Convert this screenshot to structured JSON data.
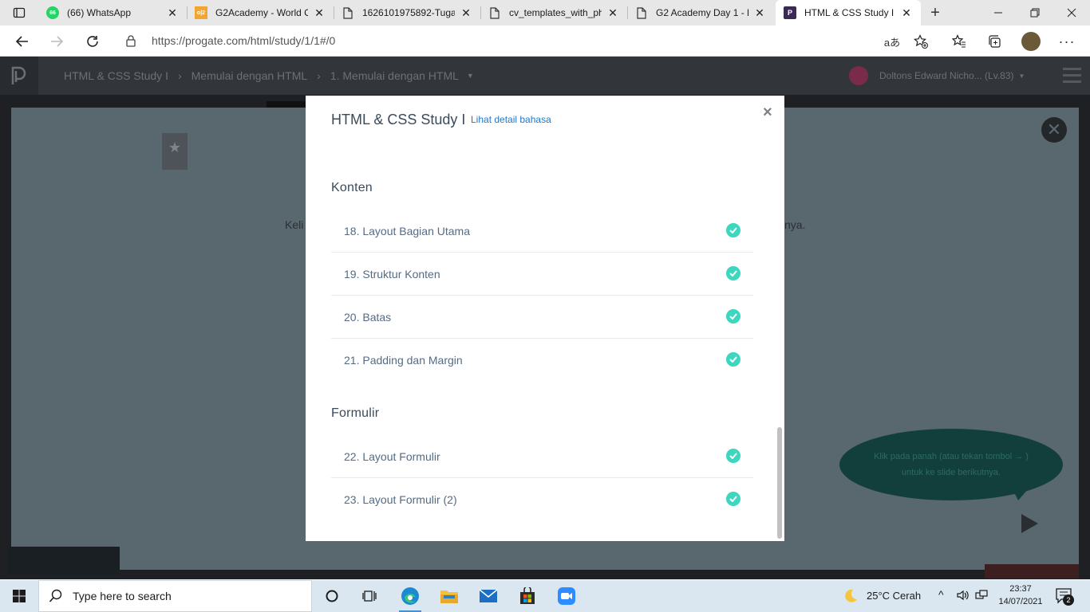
{
  "browser": {
    "tabs": [
      {
        "title": "(66) WhatsApp",
        "icon": "whatsapp-icon",
        "badge": "66",
        "active": false
      },
      {
        "title": "G2Academy - World C",
        "icon": "g2academy-icon",
        "badge": "o|2",
        "active": false
      },
      {
        "title": "1626101975892-Tugas",
        "icon": "document-icon",
        "active": false
      },
      {
        "title": "cv_templates_with_ph",
        "icon": "document-icon",
        "active": false
      },
      {
        "title": "G2 Academy Day 1 - H",
        "icon": "document-icon",
        "active": false
      },
      {
        "title": "HTML & CSS Study I |",
        "icon": "progate-icon",
        "active": true
      }
    ],
    "new_tab_label": "+",
    "url": "https://progate.com/html/study/1/1#/0"
  },
  "header": {
    "breadcrumbs": [
      "HTML & CSS Study I",
      "Memulai dengan HTML",
      "1. Memulai dengan HTML"
    ],
    "user_name": "Doltons Edward Nicho... (Lv.83)"
  },
  "background": {
    "text_left": "Keli",
    "text_right": "nya.",
    "hint": "Klik pada panah (atau tekan tombol → ) untuk ke slide berikutnya."
  },
  "modal": {
    "title": "HTML & CSS Study I",
    "detail_link": "Lihat detail bahasa",
    "close": "×",
    "sections": [
      {
        "heading": "Konten",
        "lessons": [
          {
            "label": "18. Layout Bagian Utama",
            "done": true
          },
          {
            "label": "19. Struktur Konten",
            "done": true
          },
          {
            "label": "20. Batas",
            "done": true
          },
          {
            "label": "21. Padding dan Margin",
            "done": true
          }
        ]
      },
      {
        "heading": "Formulir",
        "lessons": [
          {
            "label": "22. Layout Formulir",
            "done": true
          },
          {
            "label": "23. Layout Formulir (2)",
            "done": true
          }
        ]
      }
    ],
    "check_color": "#3dd6bf"
  },
  "taskbar": {
    "search_placeholder": "Type here to search",
    "weather": "25°C  Cerah",
    "time": "23:37",
    "date": "14/07/2021",
    "notification_count": "2"
  }
}
